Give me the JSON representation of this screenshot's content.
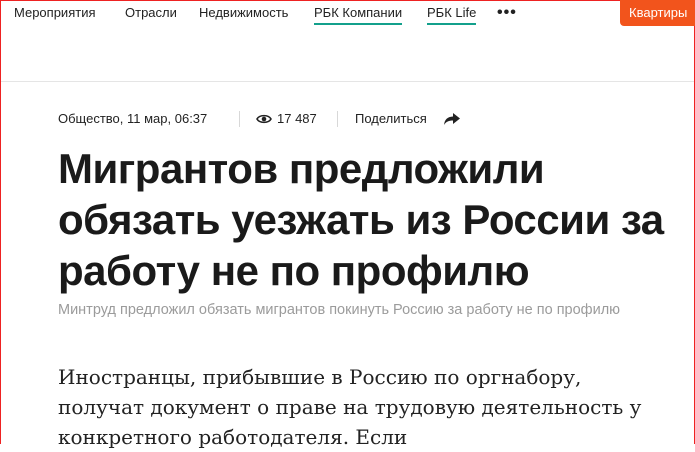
{
  "nav": {
    "items": [
      "Мероприятия",
      "Отрасли",
      "Недвижимость",
      "РБК Компании",
      "РБК Life"
    ],
    "more_label": "•••",
    "cta_label": "Квартиры",
    "underline_color": "#13a08c",
    "cta_color": "#f2541c"
  },
  "article": {
    "section_date": "Общество, 11 мар, 06:37",
    "views": "17 487",
    "share_label": "Поделиться",
    "headline": "Мигрантов предложили обязать уезжать из России за работу не по профилю",
    "subtitle": "Минтруд предложил обязать мигрантов покинуть Россию за работу не по профилю",
    "lead": "Иностранцы, прибывшие в Россию по оргнабору, получат документ о праве на трудовую деятельность у конкретного работодателя. Если"
  },
  "icons": {
    "views": "eye-icon",
    "share": "share-arrow-icon"
  }
}
